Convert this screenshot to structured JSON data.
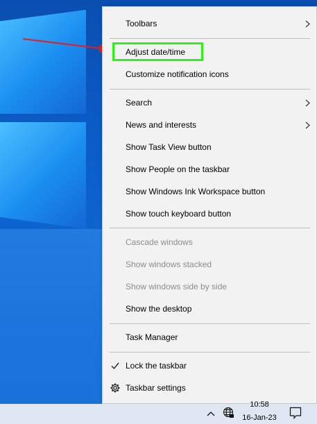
{
  "menu": {
    "items": [
      {
        "label": "Toolbars",
        "submenu": true,
        "enabled": true
      },
      {
        "label": "Adjust date/time",
        "submenu": false,
        "enabled": true,
        "highlighted": true
      },
      {
        "label": "Customize notification icons",
        "submenu": false,
        "enabled": true
      },
      {
        "label": "Search",
        "submenu": true,
        "enabled": true
      },
      {
        "label": "News and interests",
        "submenu": true,
        "enabled": true
      },
      {
        "label": "Show Task View button",
        "submenu": false,
        "enabled": true
      },
      {
        "label": "Show People on the taskbar",
        "submenu": false,
        "enabled": true
      },
      {
        "label": "Show Windows Ink Workspace button",
        "submenu": false,
        "enabled": true
      },
      {
        "label": "Show touch keyboard button",
        "submenu": false,
        "enabled": true
      },
      {
        "label": "Cascade windows",
        "submenu": false,
        "enabled": false
      },
      {
        "label": "Show windows stacked",
        "submenu": false,
        "enabled": false
      },
      {
        "label": "Show windows side by side",
        "submenu": false,
        "enabled": false
      },
      {
        "label": "Show the desktop",
        "submenu": false,
        "enabled": true
      },
      {
        "label": "Task Manager",
        "submenu": false,
        "enabled": true
      },
      {
        "label": "Lock the taskbar",
        "submenu": false,
        "enabled": true,
        "checked": true
      },
      {
        "label": "Taskbar settings",
        "submenu": false,
        "enabled": true,
        "icon": "gear-icon"
      }
    ]
  },
  "annotation": {
    "arrow_color": "#e32020",
    "highlight_color": "#2df216"
  },
  "taskbar": {
    "clock_time": "10:58",
    "clock_date": "16-Jan-23",
    "tray_icons": [
      "chevron-up-icon",
      "globe-icon",
      "notification-icon"
    ]
  },
  "colors": {
    "menu_background": "#f2f2f2",
    "disabled_text": "#8c8c8c",
    "desktop_blue": "#0b5fcc"
  }
}
